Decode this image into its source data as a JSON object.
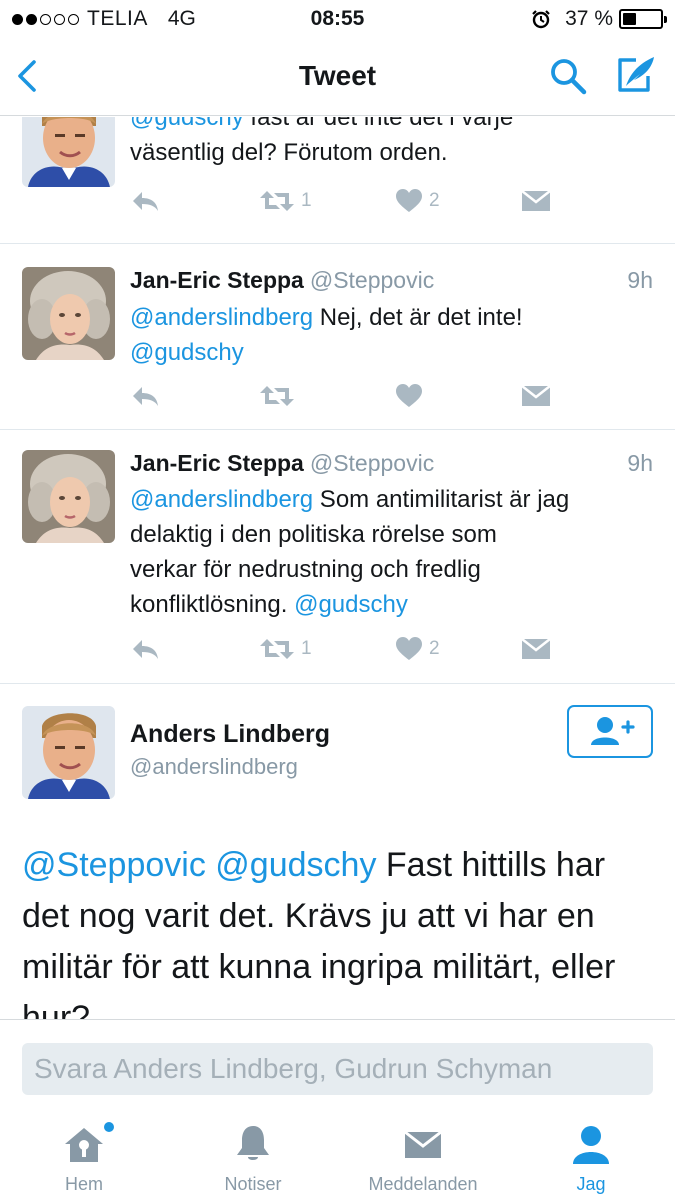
{
  "status": {
    "carrier": "TELIA",
    "network": "4G",
    "time": "08:55",
    "battery_pct": "37 %",
    "battery_level": 0.37
  },
  "nav": {
    "title": "Tweet"
  },
  "tweets": [
    {
      "name": "",
      "handle": "",
      "time": "",
      "text_lines": [
        [
          {
            "t": "@gudschy",
            "m": true
          },
          {
            "t": " fast är det inte det i varje"
          }
        ],
        [
          {
            "t": "väsentlig del? Förutom orden."
          }
        ]
      ],
      "retweets": "1",
      "likes": "2"
    },
    {
      "name": "Jan-Eric Steppa",
      "handle": "@Steppovic",
      "time": "9h",
      "text_lines": [
        [
          {
            "t": "@anderslindberg",
            "m": true
          },
          {
            "t": " Nej, det är det inte!"
          }
        ],
        [
          {
            "t": "@gudschy",
            "m": true
          }
        ]
      ],
      "retweets": "",
      "likes": ""
    },
    {
      "name": "Jan-Eric Steppa",
      "handle": "@Steppovic",
      "time": "9h",
      "text_lines": [
        [
          {
            "t": "@anderslindberg",
            "m": true
          },
          {
            "t": " Som antimilitarist är jag"
          }
        ],
        [
          {
            "t": "delaktig i den politiska rörelse som"
          }
        ],
        [
          {
            "t": "verkar för nedrustning och fredlig"
          }
        ],
        [
          {
            "t": "konfliktlösning. "
          },
          {
            "t": "@gudschy",
            "m": true
          }
        ]
      ],
      "retweets": "1",
      "likes": "2"
    }
  ],
  "expanded": {
    "name": "Anders Lindberg",
    "handle": "@anderslindberg",
    "text_lines": [
      [
        {
          "t": "@Steppovic",
          "m": true
        },
        {
          "t": " "
        },
        {
          "t": "@gudschy",
          "m": true
        },
        {
          "t": " Fast hittills har"
        }
      ],
      [
        {
          "t": "det nog varit det. Krävs ju att vi har en"
        }
      ],
      [
        {
          "t": "militär för att kunna ingripa militärt, eller"
        }
      ],
      [
        {
          "t": "hur?"
        }
      ]
    ]
  },
  "reply": {
    "placeholder": "Svara Anders Lindberg, Gudrun Schyman"
  },
  "tabs": [
    {
      "label": "Hem",
      "icon": "home-icon",
      "active": false,
      "dot": true
    },
    {
      "label": "Notiser",
      "icon": "bell-icon",
      "active": false,
      "dot": false
    },
    {
      "label": "Meddelanden",
      "icon": "envelope-icon",
      "active": false,
      "dot": false
    },
    {
      "label": "Jag",
      "icon": "person-icon",
      "active": true,
      "dot": false
    }
  ],
  "colors": {
    "accent": "#1b95e0",
    "text": "#14171a",
    "muted": "#8899a6",
    "action_gray": "#aab8c2"
  }
}
